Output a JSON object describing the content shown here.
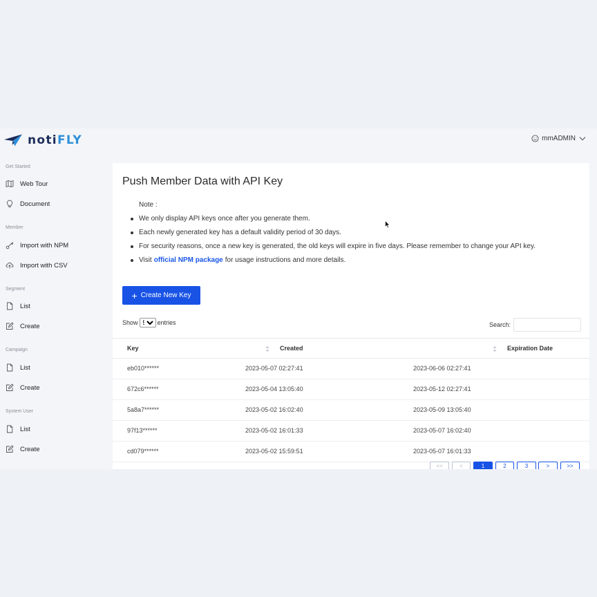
{
  "app": {
    "brand_prefix": "noti",
    "brand_suffix": "FLY",
    "user_name": "mmADMIN"
  },
  "sidebar": {
    "sections": [
      {
        "title": "Get Started",
        "items": [
          {
            "label": "Web Tour",
            "icon": "map-icon"
          },
          {
            "label": "Document",
            "icon": "lightbulb-icon"
          }
        ]
      },
      {
        "title": "Member",
        "items": [
          {
            "label": "Import with NPM",
            "icon": "key-icon"
          },
          {
            "label": "Import with CSV",
            "icon": "cloud-upload-icon"
          }
        ]
      },
      {
        "title": "Segment",
        "items": [
          {
            "label": "List",
            "icon": "file-icon"
          },
          {
            "label": "Create",
            "icon": "edit-icon"
          }
        ]
      },
      {
        "title": "Campaign",
        "items": [
          {
            "label": "List",
            "icon": "file-icon"
          },
          {
            "label": "Create",
            "icon": "edit-icon"
          }
        ]
      },
      {
        "title": "System User",
        "items": [
          {
            "label": "List",
            "icon": "file-icon"
          },
          {
            "label": "Create",
            "icon": "edit-icon"
          }
        ]
      }
    ]
  },
  "main": {
    "title": "Push Member Data with API Key",
    "note_label": "Note :",
    "notes": [
      "We only display API keys once after you generate them.",
      "Each newly generated key has a default validity period of 30 days.",
      "For security reasons, once a new key is generated, the old keys will expire in five days. Please remember to change your API key."
    ],
    "visit_prefix": "Visit",
    "visit_link": "official NPM package",
    "visit_suffix": "for usage instructions and more details.",
    "create_button": "Create New Key"
  },
  "table": {
    "show_label": "Show",
    "entries_label": "entries",
    "page_size": "5",
    "search_label": "Search:",
    "columns": [
      "Key",
      "Created",
      "Expiration Date"
    ],
    "rows": [
      [
        "eb010******",
        "2023-05-07 02:27:41",
        "2023-06-06 02:27:41"
      ],
      [
        "672c6******",
        "2023-05-04 13:05:40",
        "2023-05-12 02:27:41"
      ],
      [
        "5a8a7******",
        "2023-05-02 16:02:40",
        "2023-05-09 13:05:40"
      ],
      [
        "97f13******",
        "2023-05-02 16:01:33",
        "2023-05-07 16:02:40"
      ],
      [
        "cd079******",
        "2023-05-02 15:59:51",
        "2023-05-07 16:01:33"
      ]
    ],
    "pagination": [
      "<<",
      "<",
      "1",
      "2",
      "3",
      ">",
      ">>"
    ],
    "current_page": "1"
  },
  "colors": {
    "primary": "#1853e6",
    "brand_dark": "#1c2b5a",
    "brand_light": "#2f8fd8"
  }
}
